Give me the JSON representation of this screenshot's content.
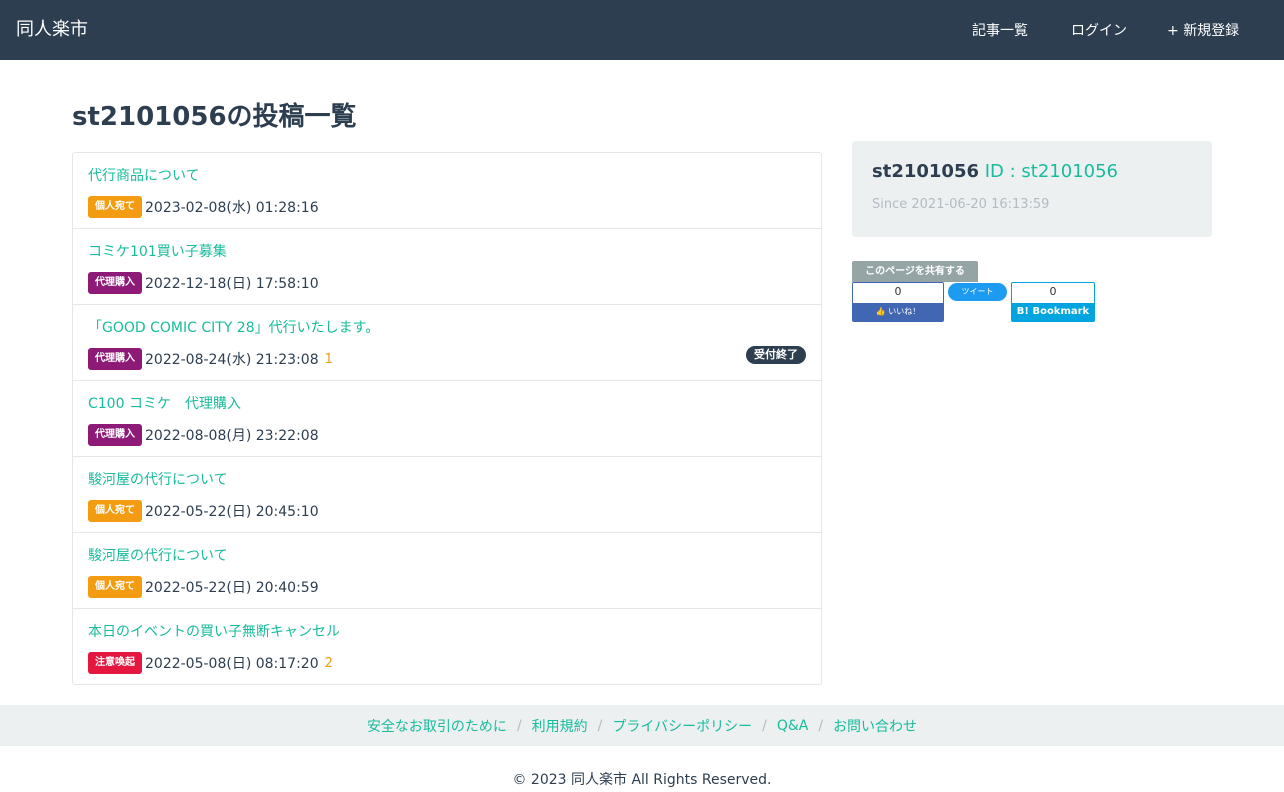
{
  "navbar": {
    "brand": "同人楽市",
    "links": [
      {
        "icon": "",
        "label": "記事一覧"
      },
      {
        "icon": "",
        "label": "ログイン"
      },
      {
        "icon": "+",
        "label": "新規登録"
      }
    ]
  },
  "page_title": "st2101056の投稿一覧",
  "posts": [
    {
      "title": "代行商品について",
      "badge": "個人宛て",
      "badge_color": "#f39c12",
      "date": "2023-02-08(水) 01:28:16",
      "comment_icon": "",
      "comment_count": "",
      "status": ""
    },
    {
      "title": "コミケ101買い子募集",
      "badge": "代理購入",
      "badge_color": "#8e1a78",
      "date": "2022-12-18(日) 17:58:10",
      "comment_icon": "",
      "comment_count": "",
      "status": ""
    },
    {
      "title": "「GOOD COMIC CITY 28」代行いたします。",
      "badge": "代理購入",
      "badge_color": "#8e1a78",
      "date": "2022-08-24(水) 21:23:08",
      "comment_icon": "",
      "comment_count": "1",
      "status": "受付終了"
    },
    {
      "title": "C100 コミケ　代理購入",
      "badge": "代理購入",
      "badge_color": "#8e1a78",
      "date": "2022-08-08(月) 23:22:08",
      "comment_icon": "",
      "comment_count": "",
      "status": ""
    },
    {
      "title": "駿河屋の代行について",
      "badge": "個人宛て",
      "badge_color": "#f39c12",
      "date": "2022-05-22(日) 20:45:10",
      "comment_icon": "",
      "comment_count": "",
      "status": ""
    },
    {
      "title": "駿河屋の代行について",
      "badge": "個人宛て",
      "badge_color": "#f39c12",
      "date": "2022-05-22(日) 20:40:59",
      "comment_icon": "",
      "comment_count": "",
      "status": ""
    },
    {
      "title": "本日のイベントの買い子無断キャンセル",
      "badge": "注意喚起",
      "badge_color": "#e3173f",
      "date": "2022-05-08(日) 08:17:20",
      "comment_icon": "",
      "comment_count": "2",
      "status": ""
    }
  ],
  "profile": {
    "user_icon": "",
    "username": "st2101056",
    "id_text": "ID : st2101056",
    "since_icon": "",
    "since": "Since 2021-06-20 16:13:59"
  },
  "share": {
    "label": "このページを共有する",
    "fb_count": "0",
    "fb_like": "👍 いいね！",
    "tweet": "ツイート",
    "hatena_count": "0",
    "hatena_label": "B! Bookmark"
  },
  "footer": {
    "links": [
      "安全なお取引のために",
      "利用規約",
      "プライバシーポリシー",
      "Q&A",
      "お問い合わせ"
    ],
    "separator": "/",
    "copyright": "© 2023 同人楽市 All Rights Reserved."
  }
}
